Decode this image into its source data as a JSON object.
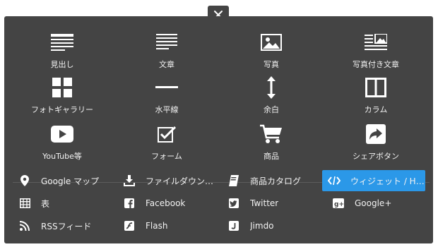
{
  "colors": {
    "panel": "#444444",
    "active": "#2b98e8",
    "text": "#f2f2f2"
  },
  "close_icon": "close-icon",
  "tiles": [
    {
      "label": "見出し",
      "icon": "heading-icon"
    },
    {
      "label": "文章",
      "icon": "text-icon"
    },
    {
      "label": "写真",
      "icon": "photo-icon"
    },
    {
      "label": "写真付き文章",
      "icon": "photo-text-icon"
    },
    {
      "label": "フォトギャラリー",
      "icon": "gallery-icon"
    },
    {
      "label": "水平線",
      "icon": "horizontal-line-icon"
    },
    {
      "label": "余白",
      "icon": "spacing-icon"
    },
    {
      "label": "カラム",
      "icon": "column-icon"
    },
    {
      "label": "YouTube等",
      "icon": "video-play-icon"
    },
    {
      "label": "フォーム",
      "icon": "form-checkbox-icon"
    },
    {
      "label": "商品",
      "icon": "shopping-cart-icon"
    },
    {
      "label": "シェアボタン",
      "icon": "share-icon"
    }
  ],
  "items": [
    {
      "label": "Google マップ",
      "icon": "map-pin-icon"
    },
    {
      "label": "ファイルダウンロード",
      "icon": "download-icon"
    },
    {
      "label": "商品カタログ",
      "icon": "catalog-icon"
    },
    {
      "label": "ウィジェット / HTML",
      "icon": "code-icon",
      "active": true
    },
    {
      "label": "表",
      "icon": "table-icon"
    },
    {
      "label": "Facebook",
      "icon": "facebook-icon"
    },
    {
      "label": "Twitter",
      "icon": "twitter-icon"
    },
    {
      "label": "Google+",
      "icon": "google-plus-icon"
    },
    {
      "label": "RSSフィード",
      "icon": "rss-icon"
    },
    {
      "label": "Flash",
      "icon": "flash-icon"
    },
    {
      "label": "Jimdo",
      "icon": "jimdo-icon"
    }
  ]
}
